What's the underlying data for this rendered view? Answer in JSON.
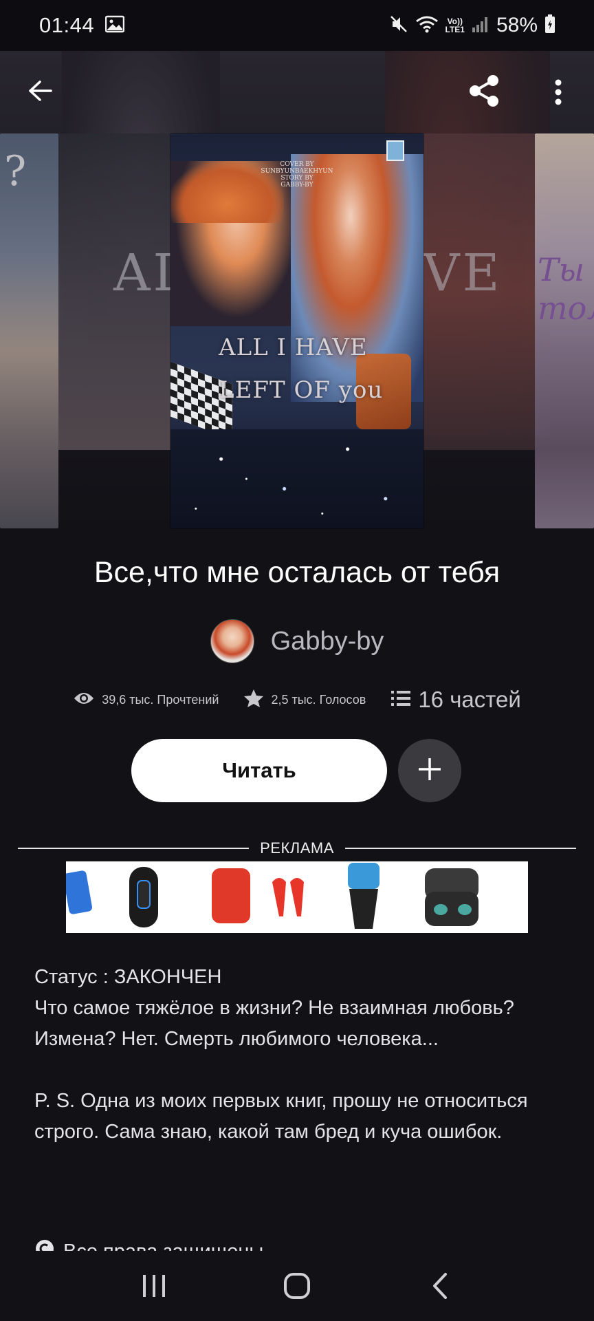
{
  "status_bar": {
    "time": "01:44",
    "volte_top": "Vo))",
    "volte_bottom": "LTE1",
    "battery": "58%"
  },
  "top_bar": {
    "back_icon": "arrow-left-icon",
    "share_icon": "share-icon",
    "more_icon": "more-vertical-icon"
  },
  "covers": {
    "main": {
      "credit_lines": [
        "COVER BY",
        "SUNBYUNBAEKHYUN",
        "STORY BY",
        "GABBY-BY"
      ],
      "title_line1": "ALL I HAVE",
      "title_line2": "LEFT OF you"
    },
    "left_partial_text": "?",
    "left_back_text": "AL",
    "right_back_text": "VE",
    "right_partial_text": "Ты\nтолько"
  },
  "book": {
    "title": "Все,что мне осталась от тебя",
    "author": "Gabby-by"
  },
  "stats": {
    "reads": "39,6 тыс. Прочтений",
    "votes": "2,5 тыс. Голосов",
    "parts": "16 частей"
  },
  "actions": {
    "read_label": "Читать",
    "add_icon": "plus-icon"
  },
  "ad": {
    "label": "РЕКЛАМА"
  },
  "description": {
    "lines": [
      "Статус : ЗАКОНЧЕН",
      "Что самое тяжёлое в жизни? Не взаимная любовь? Измена? Нет. Смерть любимого человека...",
      "",
      "P. S. Одна из моих первых книг, прошу не относиться строго. Сама знаю, какой там бред и куча ошибок."
    ],
    "rights": "Все права защищены"
  },
  "colors": {
    "background": "#121115",
    "primary_button": "#ffffff",
    "secondary_button": "#3a3a3f",
    "muted_text": "#b8b8be"
  }
}
